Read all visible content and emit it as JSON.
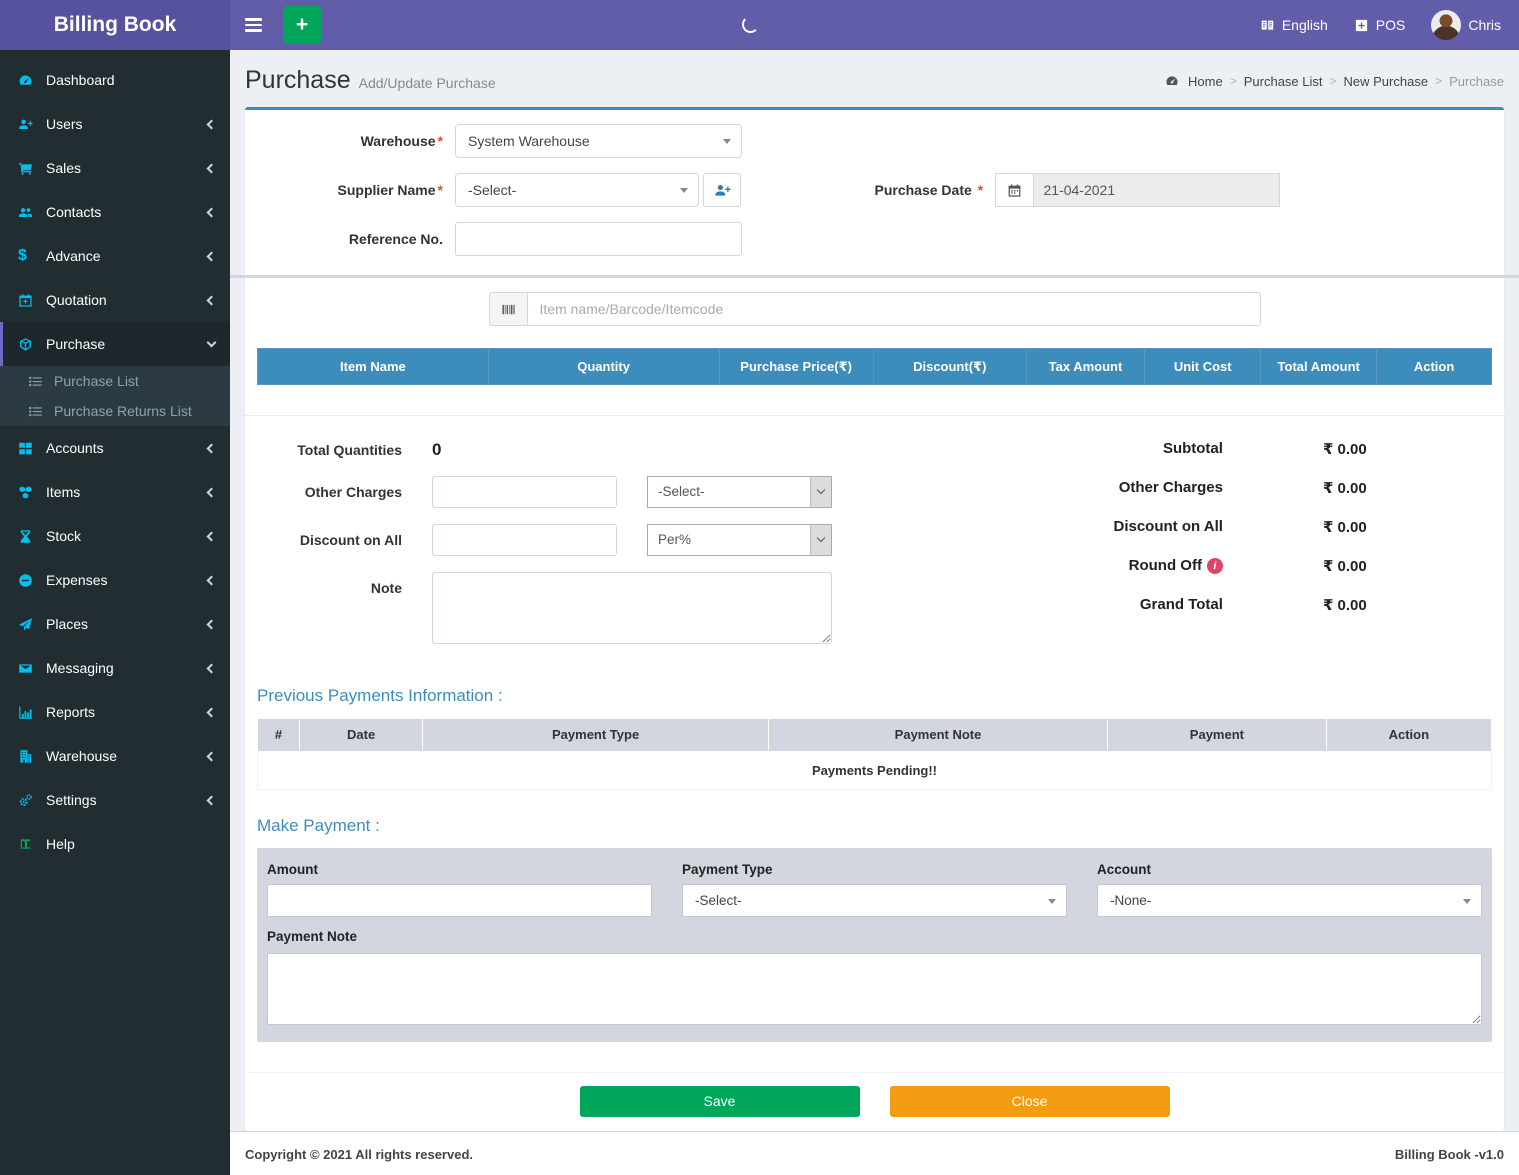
{
  "app": {
    "title": "Billing Book",
    "version": "Billing Book -v1.0",
    "copyright": "Copyright © 2021 All rights reserved."
  },
  "navbar": {
    "language_label": "English",
    "pos_label": "POS",
    "user_name": "Chris",
    "language_icon": "language-icon",
    "pos_icon": "plus-square-icon"
  },
  "sidebar": {
    "items": [
      {
        "label": "Dashboard",
        "icon": "tachometer-icon"
      },
      {
        "label": "Users",
        "icon": "user-plus-icon"
      },
      {
        "label": "Sales",
        "icon": "cart-icon"
      },
      {
        "label": "Contacts",
        "icon": "users-icon"
      },
      {
        "label": "Advance",
        "icon": "dollar-icon"
      },
      {
        "label": "Quotation",
        "icon": "calendar-plus-icon"
      },
      {
        "label": "Purchase",
        "icon": "cube-icon",
        "active": true
      },
      {
        "label": "Accounts",
        "icon": "grid-icon"
      },
      {
        "label": "Items",
        "icon": "cubes-icon"
      },
      {
        "label": "Stock",
        "icon": "hourglass-icon"
      },
      {
        "label": "Expenses",
        "icon": "minus-circle-icon"
      },
      {
        "label": "Places",
        "icon": "paper-plane-icon"
      },
      {
        "label": "Messaging",
        "icon": "envelope-icon"
      },
      {
        "label": "Reports",
        "icon": "bar-chart-icon"
      },
      {
        "label": "Warehouse",
        "icon": "building-icon"
      },
      {
        "label": "Settings",
        "icon": "gears-icon"
      },
      {
        "label": "Help",
        "icon": "book-icon"
      }
    ],
    "submenu": [
      {
        "label": "Purchase List",
        "icon": "list-icon"
      },
      {
        "label": "Purchase Returns List",
        "icon": "list-icon"
      }
    ]
  },
  "page": {
    "title": "Purchase",
    "subtitle": "Add/Update Purchase",
    "breadcrumb": [
      "Home",
      "Purchase List",
      "New Purchase",
      "Purchase"
    ]
  },
  "form": {
    "required_mark": "*",
    "warehouse_label": "Warehouse",
    "warehouse_value": "System Warehouse",
    "supplier_label": "Supplier Name",
    "supplier_value": "-Select-",
    "reference_label": "Reference No.",
    "purchase_date_label": "Purchase Date",
    "purchase_date_value": "21-04-2021"
  },
  "items_section": {
    "search_placeholder": "Item name/Barcode/Itemcode",
    "columns": [
      "Item Name",
      "Quantity",
      "Purchase Price(₹)",
      "Discount(₹)",
      "Tax Amount",
      "Unit Cost",
      "Total Amount",
      "Action"
    ]
  },
  "totals": {
    "total_quantities_label": "Total Quantities",
    "total_quantities_value": "0",
    "other_charges_label": "Other Charges",
    "other_charges_type_value": "-Select-",
    "discount_on_all_label": "Discount on All",
    "discount_type_value": "Per%",
    "note_label": "Note",
    "summary": [
      {
        "label": "Subtotal",
        "value": "₹ 0.00"
      },
      {
        "label": "Other Charges",
        "value": "₹ 0.00"
      },
      {
        "label": "Discount on All",
        "value": "₹ 0.00"
      },
      {
        "label": "Round Off",
        "value": "₹ 0.00"
      },
      {
        "label": "Grand Total",
        "value": "₹ 0.00"
      }
    ]
  },
  "previous_payments": {
    "heading": "Previous Payments Information :",
    "columns": [
      "#",
      "Date",
      "Payment Type",
      "Payment Note",
      "Payment",
      "Action"
    ],
    "empty_message": "Payments Pending!!"
  },
  "make_payment": {
    "heading": "Make Payment :",
    "amount_label": "Amount",
    "payment_type_label": "Payment Type",
    "payment_type_value": "-Select-",
    "account_label": "Account",
    "account_value": "-None-",
    "payment_note_label": "Payment Note"
  },
  "actions": {
    "save_label": "Save",
    "close_label": "Close"
  },
  "colors": {
    "navbar_purple": "#615da9",
    "box_accent_blue": "#3c8dbc",
    "sidebar_icon_cyan": "#00c0ef",
    "save_green": "#00a65a",
    "close_orange": "#f39c12",
    "danger_red": "#dd4b39"
  }
}
